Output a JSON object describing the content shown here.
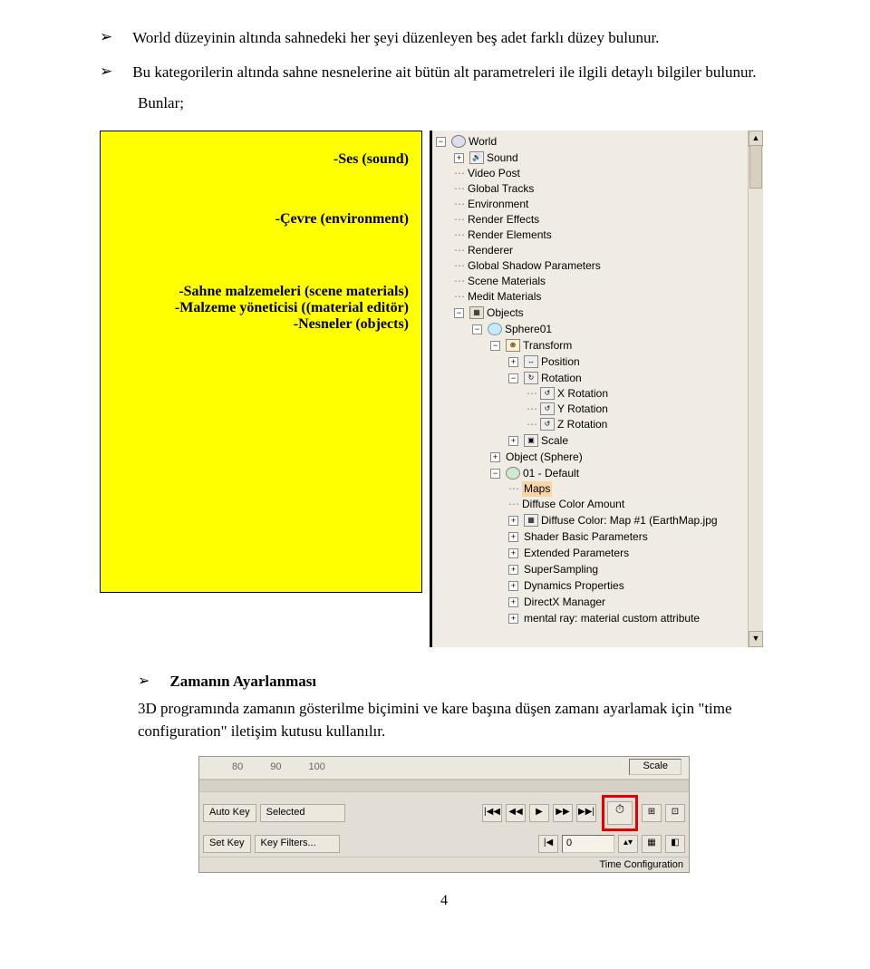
{
  "bullets": [
    "World düzeyinin altında sahnedeki her şeyi düzenleyen beş adet farklı düzey bulunur.",
    "Bu kategorilerin altında sahne nesnelerine ait bütün alt parametreleri ile ilgili detaylı bilgiler bulunur."
  ],
  "bunlar": "Bunlar;",
  "yellow": {
    "l1": "-Ses (sound)",
    "l2": "-Çevre (environment)",
    "l3": "-Sahne malzemeleri (scene materials)",
    "l4": "-Malzeme yöneticisi ((material editör)",
    "l5": "-Nesneler (objects)"
  },
  "tree": {
    "root": "World",
    "n1": "Sound",
    "n2": "Video Post",
    "n3": "Global Tracks",
    "n4": "Environment",
    "n5": "Render Effects",
    "n6": "Render Elements",
    "n7": "Renderer",
    "n8": "Global Shadow Parameters",
    "n9": "Scene Materials",
    "n10": "Medit Materials",
    "objects": "Objects",
    "sphere": "Sphere01",
    "transform": "Transform",
    "pos": "Position",
    "rot": "Rotation",
    "xr": "X Rotation",
    "yr": "Y Rotation",
    "zr": "Z Rotation",
    "scale": "Scale",
    "objsphere": "Object (Sphere)",
    "def": "01 - Default",
    "maps": "Maps",
    "d1": "Diffuse Color Amount",
    "d2": "Diffuse Color: Map #1 (EarthMap.jpg",
    "d3": "Shader Basic Parameters",
    "d4": "Extended Parameters",
    "d5": "SuperSampling",
    "d6": "Dynamics Properties",
    "d7": "DirectX Manager",
    "d8": "mental ray: material custom attribute"
  },
  "section": {
    "title": "Zamanın Ayarlanması",
    "para": "3D programında zamanın gösterilme biçimini ve kare başına düşen zamanı ayarlamak için \"time configuration\" iletişim kutusu kullanılır."
  },
  "bottom": {
    "ticks": [
      "80",
      "90",
      "100"
    ],
    "scale": "Scale",
    "autokey": "Auto Key",
    "selected": "Selected",
    "setkey": "Set Key",
    "keyfilters": "Key Filters...",
    "frame": "0",
    "status": "Time Configuration"
  },
  "pagenum": "4"
}
